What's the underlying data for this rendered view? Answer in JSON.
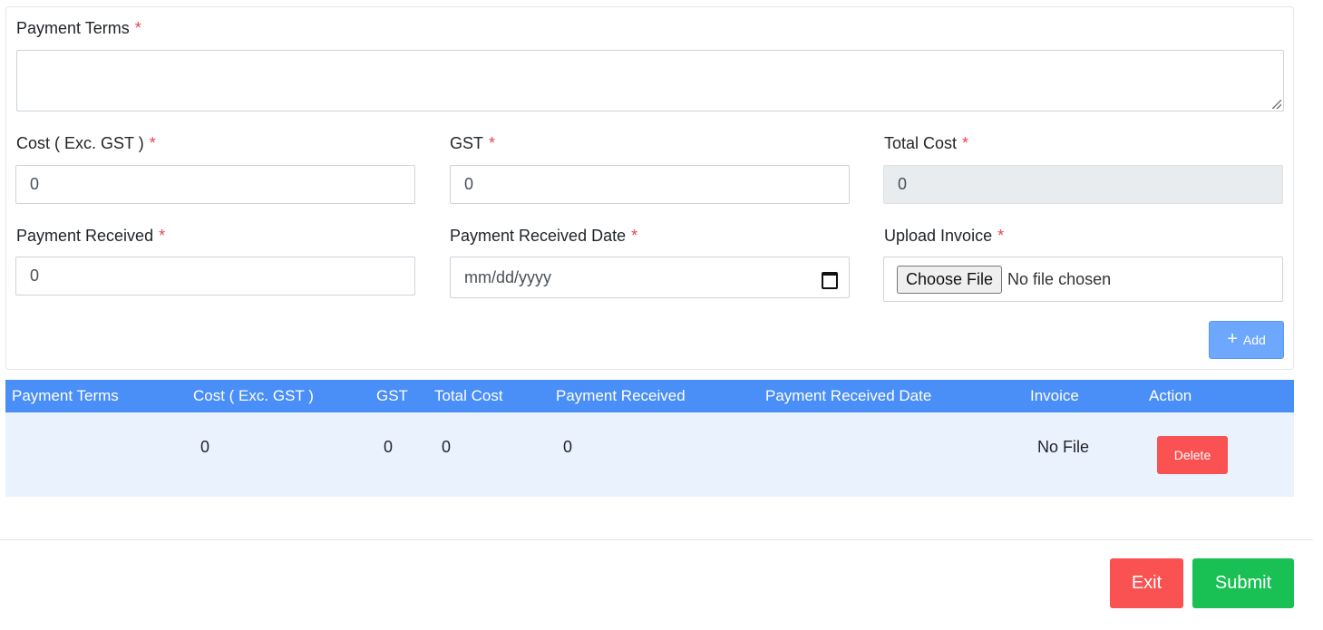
{
  "form": {
    "payment_terms": {
      "label": "Payment Terms",
      "required": "*",
      "value": ""
    },
    "cost_exc_gst": {
      "label": "Cost ( Exc. GST )",
      "required": "*",
      "value": "0"
    },
    "gst": {
      "label": "GST",
      "required": "*",
      "value": "0"
    },
    "total_cost": {
      "label": "Total Cost",
      "required": "*",
      "value": "0"
    },
    "payment_received": {
      "label": "Payment Received",
      "required": "*",
      "value": "0"
    },
    "payment_received_date": {
      "label": "Payment Received Date",
      "required": "*",
      "placeholder": "mm/dd/yyyy"
    },
    "upload_invoice": {
      "label": "Upload Invoice",
      "required": "*",
      "button_label": "Choose File",
      "status": "No file chosen"
    },
    "add_button": {
      "icon": "+",
      "label": "Add"
    }
  },
  "table": {
    "headers": [
      "Payment Terms",
      "Cost ( Exc. GST )",
      "GST",
      "Total Cost",
      "Payment Received",
      "Payment Received Date",
      "Invoice",
      "Action"
    ],
    "rows": [
      {
        "payment_terms": "",
        "cost_exc_gst": "0",
        "gst": "0",
        "total_cost": "0",
        "payment_received": "0",
        "payment_received_date": "",
        "invoice": "No File",
        "action_label": "Delete"
      }
    ]
  },
  "footer": {
    "exit_label": "Exit",
    "submit_label": "Submit"
  },
  "colors": {
    "table_header": "#4a8ef8",
    "table_row": "#eaf2fe",
    "add_button": "#6ea8fe",
    "danger": "#fa5252",
    "success": "#19c154",
    "required": "#e5484d"
  }
}
